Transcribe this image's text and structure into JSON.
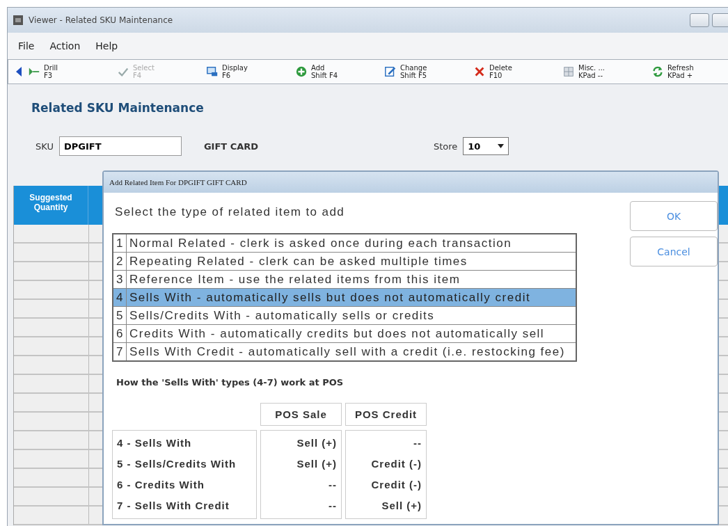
{
  "window": {
    "title": "Viewer - Related SKU Maintenance"
  },
  "menu": [
    "File",
    "Action",
    "Help"
  ],
  "toolbar": [
    {
      "kind": "drill",
      "label": "Drill",
      "key": "F3",
      "disabled": false
    },
    {
      "kind": "select",
      "label": "Select",
      "key": "F4",
      "disabled": true
    },
    {
      "kind": "display",
      "label": "Display",
      "key": "F6",
      "disabled": false
    },
    {
      "kind": "add",
      "label": "Add",
      "key": "Shift F4",
      "disabled": false
    },
    {
      "kind": "change",
      "label": "Change",
      "key": "Shift F5",
      "disabled": false
    },
    {
      "kind": "delete",
      "label": "Delete",
      "key": "F10",
      "disabled": false
    },
    {
      "kind": "misc",
      "label": "Misc. ...",
      "key": "KPad --",
      "disabled": false
    },
    {
      "kind": "refresh",
      "label": "Refresh",
      "key": "KPad +",
      "disabled": false
    }
  ],
  "heading": "Related SKU Maintenance",
  "sku": {
    "label": "SKU",
    "value": "DPGIFT",
    "description": "GIFT CARD"
  },
  "store": {
    "label": "Store",
    "value": "10"
  },
  "grid": {
    "columns": [
      "Suggested Quantity"
    ]
  },
  "dialog": {
    "title": "Add Related Item For DPGIFT GIFT CARD",
    "prompt": "Select the type of related item to add",
    "options": [
      {
        "number": "1",
        "text": "Normal Related - clerk is asked once during each transaction",
        "selected": false
      },
      {
        "number": "2",
        "text": "Repeating Related - clerk can be asked multiple times",
        "selected": false
      },
      {
        "number": "3",
        "text": "Reference Item - use the related items from this item",
        "selected": false
      },
      {
        "number": "4",
        "text": "Sells With - automatically sells but does not automatically credit",
        "selected": true
      },
      {
        "number": "5",
        "text": "Sells/Credits With - automatically sells or credits",
        "selected": false
      },
      {
        "number": "6",
        "text": "Credits With - automatically credits but does not automatically sell",
        "selected": false
      },
      {
        "number": "7",
        "text": "Sells With Credit - automatically sell with a credit (i.e. restocking fee)",
        "selected": false
      }
    ],
    "buttons": [
      "OK",
      "Cancel"
    ],
    "table_title": "How the 'Sells With' types (4-7) work at POS",
    "table": {
      "columns": [
        "POS Sale",
        "POS Credit"
      ],
      "rows": [
        {
          "type": "4 - Sells With",
          "sale": "Sell (+)",
          "credit": "--"
        },
        {
          "type": "5 - Sells/Credits With",
          "sale": "Sell (+)",
          "credit": "Credit (-)"
        },
        {
          "type": "6 - Credits With",
          "sale": "--",
          "credit": "Credit (-)"
        },
        {
          "type": "7 - Sells With Credit",
          "sale": "--",
          "credit": "Sell (+)"
        }
      ]
    }
  }
}
